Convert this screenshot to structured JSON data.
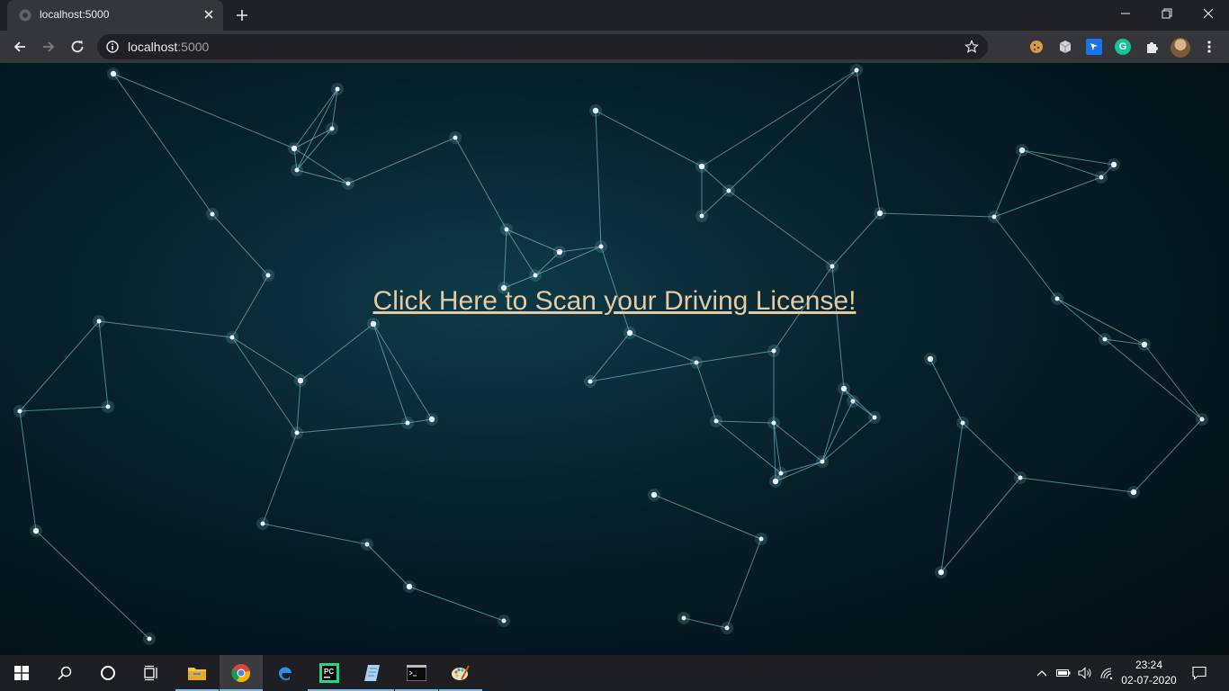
{
  "browser": {
    "tab_title": "localhost:5000",
    "address_host": "localhost",
    "address_port": ":5000"
  },
  "page": {
    "link_text": "Click Here to Scan your Driving License!",
    "link_color": "#e7c9a1"
  },
  "taskbar": {
    "time": "23:24",
    "date": "02-07-2020"
  },
  "theme": {
    "network_line": "#8fd3e6",
    "network_node": "#e6f7ff"
  }
}
